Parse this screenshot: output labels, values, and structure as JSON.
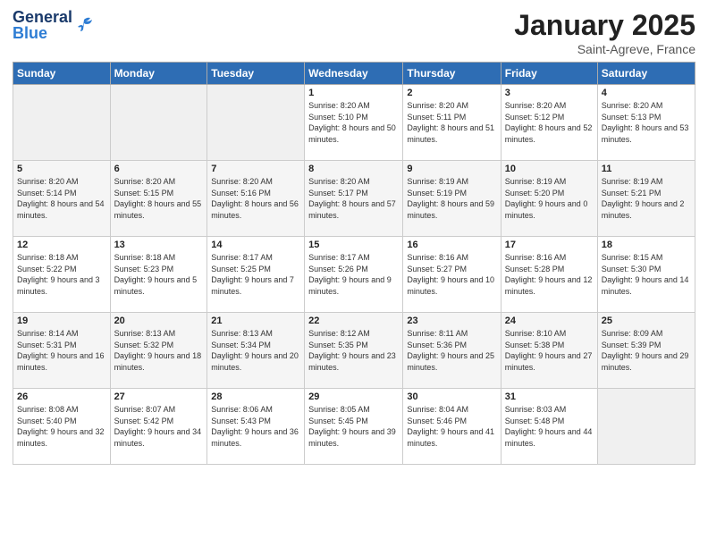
{
  "header": {
    "logo_general": "General",
    "logo_blue": "Blue",
    "month": "January 2025",
    "location": "Saint-Agreve, France"
  },
  "days_of_week": [
    "Sunday",
    "Monday",
    "Tuesday",
    "Wednesday",
    "Thursday",
    "Friday",
    "Saturday"
  ],
  "weeks": [
    {
      "shaded": false,
      "days": [
        {
          "num": "",
          "info": ""
        },
        {
          "num": "",
          "info": ""
        },
        {
          "num": "",
          "info": ""
        },
        {
          "num": "1",
          "info": "Sunrise: 8:20 AM\nSunset: 5:10 PM\nDaylight: 8 hours\nand 50 minutes."
        },
        {
          "num": "2",
          "info": "Sunrise: 8:20 AM\nSunset: 5:11 PM\nDaylight: 8 hours\nand 51 minutes."
        },
        {
          "num": "3",
          "info": "Sunrise: 8:20 AM\nSunset: 5:12 PM\nDaylight: 8 hours\nand 52 minutes."
        },
        {
          "num": "4",
          "info": "Sunrise: 8:20 AM\nSunset: 5:13 PM\nDaylight: 8 hours\nand 53 minutes."
        }
      ]
    },
    {
      "shaded": true,
      "days": [
        {
          "num": "5",
          "info": "Sunrise: 8:20 AM\nSunset: 5:14 PM\nDaylight: 8 hours\nand 54 minutes."
        },
        {
          "num": "6",
          "info": "Sunrise: 8:20 AM\nSunset: 5:15 PM\nDaylight: 8 hours\nand 55 minutes."
        },
        {
          "num": "7",
          "info": "Sunrise: 8:20 AM\nSunset: 5:16 PM\nDaylight: 8 hours\nand 56 minutes."
        },
        {
          "num": "8",
          "info": "Sunrise: 8:20 AM\nSunset: 5:17 PM\nDaylight: 8 hours\nand 57 minutes."
        },
        {
          "num": "9",
          "info": "Sunrise: 8:19 AM\nSunset: 5:19 PM\nDaylight: 8 hours\nand 59 minutes."
        },
        {
          "num": "10",
          "info": "Sunrise: 8:19 AM\nSunset: 5:20 PM\nDaylight: 9 hours\nand 0 minutes."
        },
        {
          "num": "11",
          "info": "Sunrise: 8:19 AM\nSunset: 5:21 PM\nDaylight: 9 hours\nand 2 minutes."
        }
      ]
    },
    {
      "shaded": false,
      "days": [
        {
          "num": "12",
          "info": "Sunrise: 8:18 AM\nSunset: 5:22 PM\nDaylight: 9 hours\nand 3 minutes."
        },
        {
          "num": "13",
          "info": "Sunrise: 8:18 AM\nSunset: 5:23 PM\nDaylight: 9 hours\nand 5 minutes."
        },
        {
          "num": "14",
          "info": "Sunrise: 8:17 AM\nSunset: 5:25 PM\nDaylight: 9 hours\nand 7 minutes."
        },
        {
          "num": "15",
          "info": "Sunrise: 8:17 AM\nSunset: 5:26 PM\nDaylight: 9 hours\nand 9 minutes."
        },
        {
          "num": "16",
          "info": "Sunrise: 8:16 AM\nSunset: 5:27 PM\nDaylight: 9 hours\nand 10 minutes."
        },
        {
          "num": "17",
          "info": "Sunrise: 8:16 AM\nSunset: 5:28 PM\nDaylight: 9 hours\nand 12 minutes."
        },
        {
          "num": "18",
          "info": "Sunrise: 8:15 AM\nSunset: 5:30 PM\nDaylight: 9 hours\nand 14 minutes."
        }
      ]
    },
    {
      "shaded": true,
      "days": [
        {
          "num": "19",
          "info": "Sunrise: 8:14 AM\nSunset: 5:31 PM\nDaylight: 9 hours\nand 16 minutes."
        },
        {
          "num": "20",
          "info": "Sunrise: 8:13 AM\nSunset: 5:32 PM\nDaylight: 9 hours\nand 18 minutes."
        },
        {
          "num": "21",
          "info": "Sunrise: 8:13 AM\nSunset: 5:34 PM\nDaylight: 9 hours\nand 20 minutes."
        },
        {
          "num": "22",
          "info": "Sunrise: 8:12 AM\nSunset: 5:35 PM\nDaylight: 9 hours\nand 23 minutes."
        },
        {
          "num": "23",
          "info": "Sunrise: 8:11 AM\nSunset: 5:36 PM\nDaylight: 9 hours\nand 25 minutes."
        },
        {
          "num": "24",
          "info": "Sunrise: 8:10 AM\nSunset: 5:38 PM\nDaylight: 9 hours\nand 27 minutes."
        },
        {
          "num": "25",
          "info": "Sunrise: 8:09 AM\nSunset: 5:39 PM\nDaylight: 9 hours\nand 29 minutes."
        }
      ]
    },
    {
      "shaded": false,
      "days": [
        {
          "num": "26",
          "info": "Sunrise: 8:08 AM\nSunset: 5:40 PM\nDaylight: 9 hours\nand 32 minutes."
        },
        {
          "num": "27",
          "info": "Sunrise: 8:07 AM\nSunset: 5:42 PM\nDaylight: 9 hours\nand 34 minutes."
        },
        {
          "num": "28",
          "info": "Sunrise: 8:06 AM\nSunset: 5:43 PM\nDaylight: 9 hours\nand 36 minutes."
        },
        {
          "num": "29",
          "info": "Sunrise: 8:05 AM\nSunset: 5:45 PM\nDaylight: 9 hours\nand 39 minutes."
        },
        {
          "num": "30",
          "info": "Sunrise: 8:04 AM\nSunset: 5:46 PM\nDaylight: 9 hours\nand 41 minutes."
        },
        {
          "num": "31",
          "info": "Sunrise: 8:03 AM\nSunset: 5:48 PM\nDaylight: 9 hours\nand 44 minutes."
        },
        {
          "num": "",
          "info": ""
        }
      ]
    }
  ]
}
